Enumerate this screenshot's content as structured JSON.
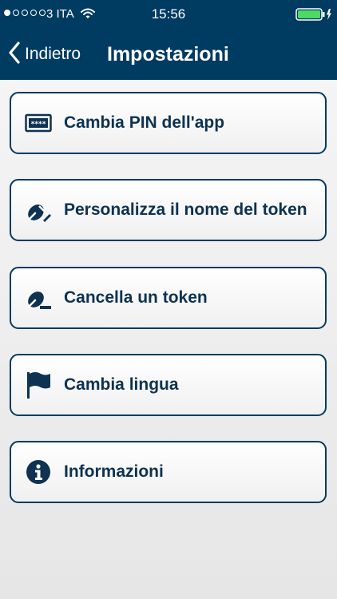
{
  "status_bar": {
    "carrier": "3 ITA",
    "time": "15:56",
    "signal_strength": 1,
    "signal_total": 5,
    "battery_level": 1.0,
    "battery_color": "#4cd964"
  },
  "nav_bar": {
    "back_label": "Indietro",
    "title": "Impostazioni",
    "background_color": "#003b61"
  },
  "menu": {
    "items": [
      {
        "label": "Cambia PIN dell'app",
        "icon": "pin-card-icon"
      },
      {
        "label": "Personalizza il nome del token",
        "icon": "edit-pen-icon"
      },
      {
        "label": "Cancella un token",
        "icon": "delete-token-icon"
      },
      {
        "label": "Cambia lingua",
        "icon": "flag-icon"
      },
      {
        "label": "Informazioni",
        "icon": "info-icon"
      }
    ]
  }
}
